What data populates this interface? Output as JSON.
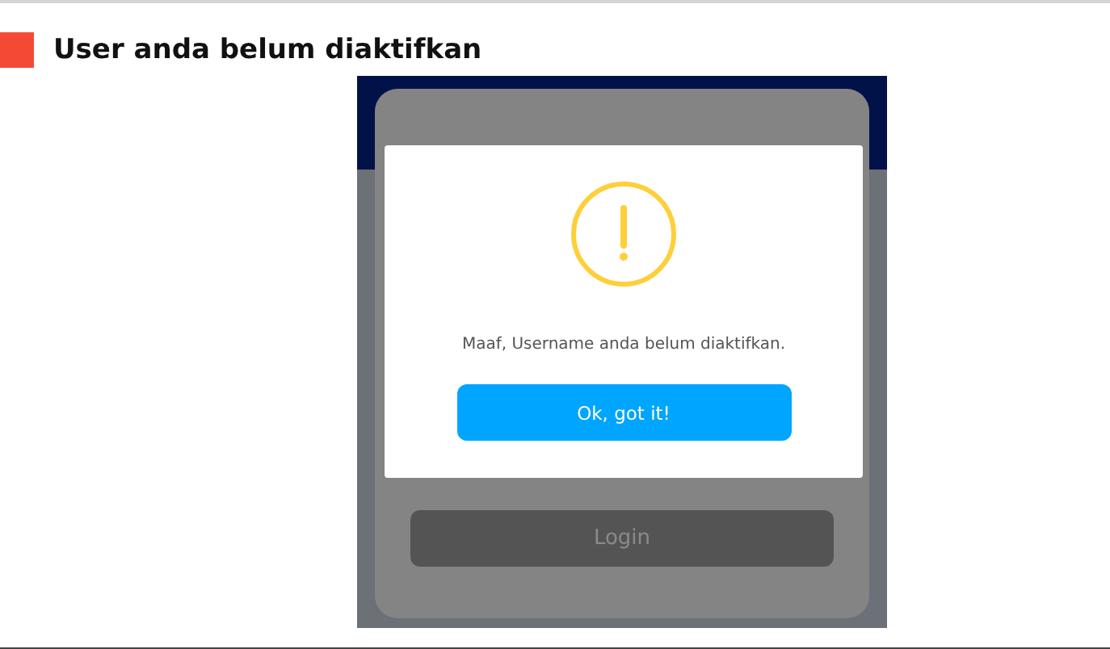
{
  "heading": "User anda belum diaktifkan",
  "screenshot": {
    "login_button": {
      "label": "Login",
      "disabled": true
    },
    "dialog": {
      "kind": "warning",
      "message": "Maaf, Username anda belum diaktifkan.",
      "button": "Ok, got it!"
    }
  }
}
